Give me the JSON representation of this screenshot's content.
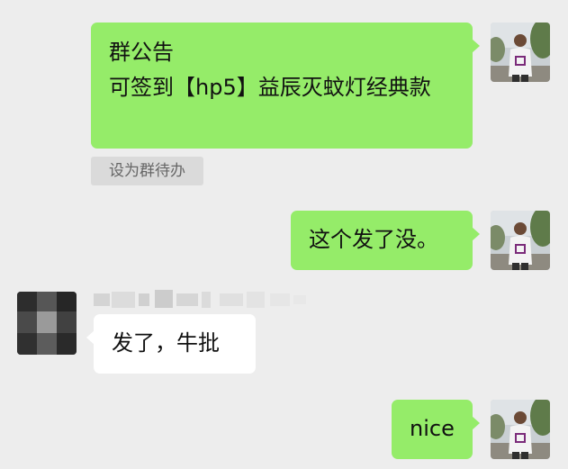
{
  "messages": [
    {
      "title": "群公告",
      "body": "可签到【hp5】益辰灭蚊灯经典款"
    },
    {
      "text": "这个发了没。"
    },
    {
      "text": "发了，牛批"
    },
    {
      "text": "nice"
    }
  ],
  "announcement_action": {
    "label": "设为群待办"
  },
  "colors": {
    "sent_bubble": "#95ec69",
    "received_bubble": "#ffffff",
    "background": "#ededed"
  },
  "icons": {
    "self_avatar": "avatar-photo-icon",
    "other_avatar": "blurred-avatar-icon"
  }
}
